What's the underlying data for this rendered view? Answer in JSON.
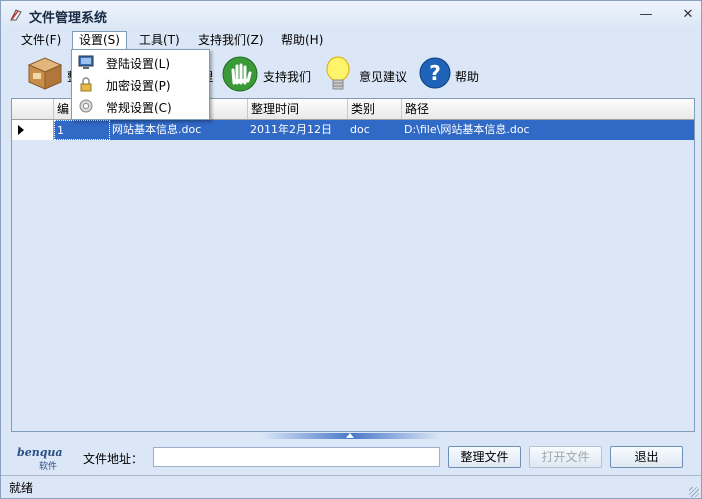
{
  "window": {
    "title": "文件管理系统",
    "minimize_label": "—",
    "close_label": "✕"
  },
  "menu": {
    "items": [
      {
        "label": "文件(F)"
      },
      {
        "label": "设置(S)"
      },
      {
        "label": "工具(T)"
      },
      {
        "label": "支持我们(Z)"
      },
      {
        "label": "帮助(H)"
      }
    ]
  },
  "dropdown": {
    "items": [
      {
        "label": "登陆设置(L)",
        "icon": "monitor-icon"
      },
      {
        "label": "加密设置(P)",
        "icon": "lock-icon"
      },
      {
        "label": "常规设置(C)",
        "icon": "settings-icon"
      }
    ]
  },
  "toolbar": {
    "items": [
      {
        "label": "整",
        "icon": "box-icon"
      },
      {
        "label": "理",
        "icon": "organize-icon"
      },
      {
        "label": "支持我们",
        "icon": "hand-icon"
      },
      {
        "label": "意见建议",
        "icon": "lightbulb-icon"
      },
      {
        "label": "帮助",
        "icon": "help-icon"
      }
    ]
  },
  "grid": {
    "columns": [
      "编",
      "",
      "整理时间",
      "类别",
      "路径"
    ],
    "rows": [
      {
        "id": "1",
        "name": "网站基本信息.doc",
        "time": "2011年2月12日",
        "type": "doc",
        "path": "D:\\file\\网站基本信息.doc"
      }
    ]
  },
  "footer": {
    "logo": "benqua",
    "logo_sub": "软件",
    "address_label": "文件地址：",
    "address_value": "",
    "organize_button": "整理文件",
    "open_button": "打开文件",
    "exit_button": "退出",
    "status": "就绪"
  },
  "colors": {
    "accent": "#3169c6",
    "background": "#dbe7f6"
  }
}
